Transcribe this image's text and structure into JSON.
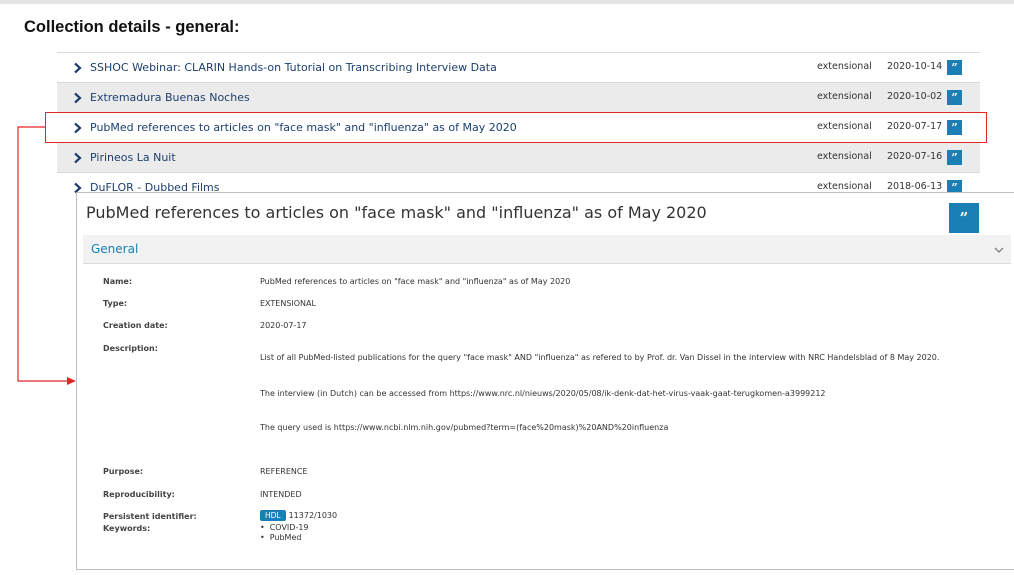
{
  "heading": "Collection details - general:",
  "collections": [
    {
      "title": "SSHOC Webinar: CLARIN Hands-on Tutorial on Transcribing Interview Data",
      "type": "extensional",
      "date": "2020-10-14"
    },
    {
      "title": "Extremadura Buenas Noches",
      "type": "extensional",
      "date": "2020-10-02"
    },
    {
      "title": "PubMed references to articles on \"face mask\" and \"influenza\" as of May 2020",
      "type": "extensional",
      "date": "2020-07-17"
    },
    {
      "title": "Pirineos La Nuit",
      "type": "extensional",
      "date": "2020-07-16"
    },
    {
      "title": "DuFLOR - Dubbed Films",
      "type": "extensional",
      "date": "2018-06-13"
    }
  ],
  "colors": {
    "accent": "#1a7fb5",
    "link": "#1c3f6e",
    "highlight": "#e32626"
  },
  "icons": {
    "row_expand": "chevron-right-icon",
    "cite": "quote-icon",
    "section_toggle": "chevron-down-icon"
  },
  "detail": {
    "title": "PubMed references to articles on \"face mask\" and \"influenza\" as of May 2020",
    "section_label": "General",
    "fields": {
      "name_label": "Name:",
      "name_value": "PubMed references to articles on \"face mask\" and \"influenza\" as of May 2020",
      "type_label": "Type:",
      "type_value": "EXTENSIONAL",
      "creation_label": "Creation date:",
      "creation_value": "2020-07-17",
      "description_label": "Description:",
      "description_lines": [
        "List of all PubMed-listed publications for the query \"face mask\" AND \"influenza\" as refered to by Prof. dr. Van Dissel in the interview with NRC Handelsblad of 8 May 2020.",
        "The interview (in Dutch) can be accessed from https://www.nrc.nl/nieuws/2020/05/08/ik-denk-dat-het-virus-vaak-gaat-terugkomen-a3999212",
        "The query used is https://www.ncbi.nlm.nih.gov/pubmed?term=(face%20mask)%20AND%20influenza"
      ],
      "purpose_label": "Purpose:",
      "purpose_value": "REFERENCE",
      "reproducibility_label": "Reproducibility:",
      "reproducibility_value": "INTENDED",
      "pid_label": "Persistent identifier:",
      "pid_badge": "HDL",
      "pid_value": "11372/1030",
      "keywords_label": "Keywords:",
      "keywords": [
        "COVID-19",
        "PubMed"
      ]
    }
  }
}
